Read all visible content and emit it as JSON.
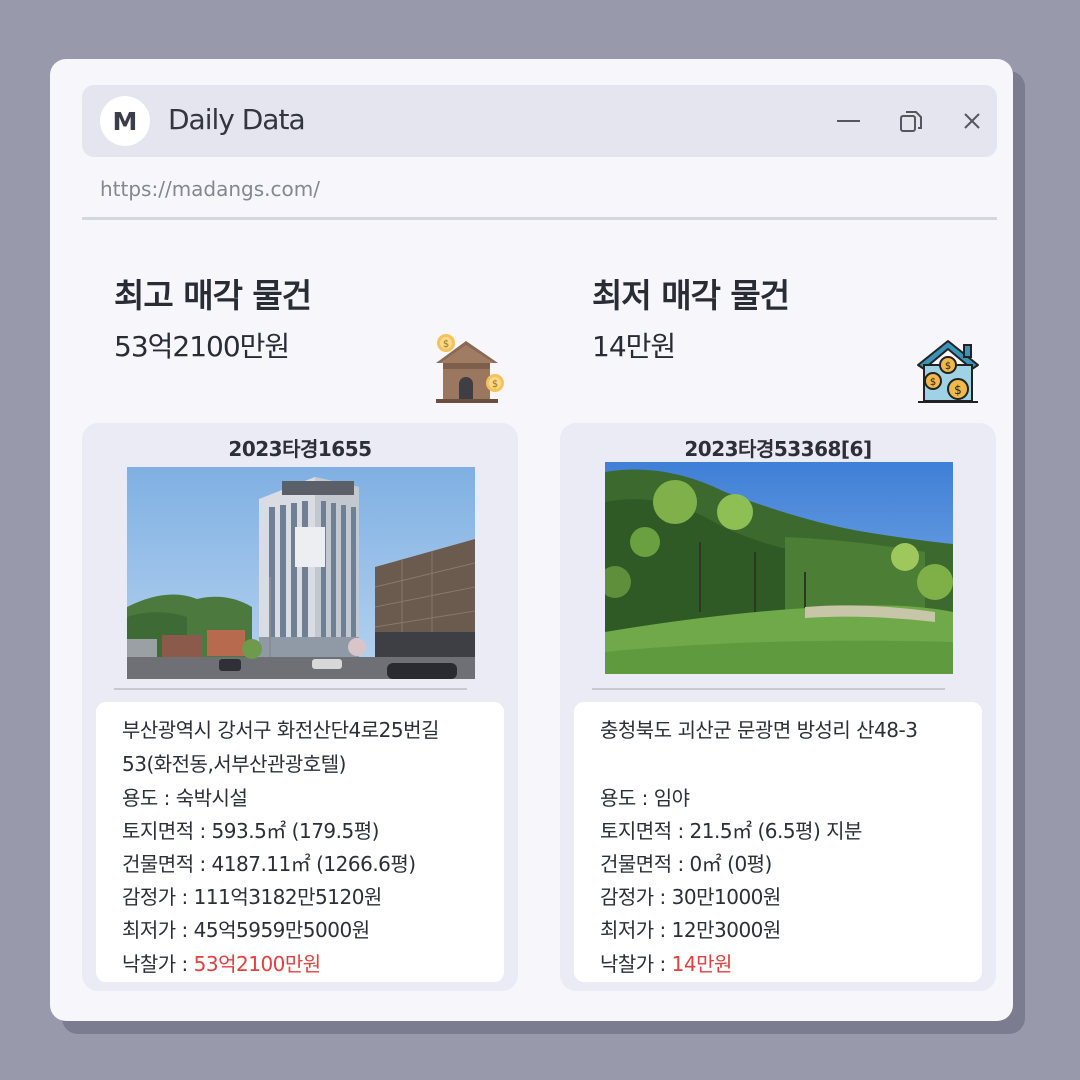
{
  "window": {
    "logo_letter": "M",
    "title": "Daily Data",
    "url": "https://madangs.com/"
  },
  "icons": {
    "minimize": "minimize-icon",
    "restore": "restore-icon",
    "close": "close-icon",
    "house_coin": "house-coin-icon",
    "house_money": "house-money-icon"
  },
  "highest": {
    "heading": "최고 매각 물건",
    "price": "53억2100만원",
    "case_no": "2023타경1655",
    "address_line1": "부산광역시 강서구 화전산단4로25번길",
    "address_line2": "53(화전동,서부산관광호텔)",
    "usage": "용도 : 숙박시설",
    "land_area": "토지면적 : 593.5㎡ (179.5평)",
    "building_area": "건물면적 : 4187.11㎡ (1266.6평)",
    "appraisal": "감정가 : 111억3182만5120원",
    "minimum": "최저가 : 45억5959만5000원",
    "winning_label": "낙찰가 : ",
    "winning_value": "53억2100만원"
  },
  "lowest": {
    "heading": "최저 매각 물건",
    "price": "14만원",
    "case_no": "2023타경53368[6]",
    "address_line1": "충청북도 괴산군 문광면 방성리 산48-3",
    "usage": "용도 : 임야",
    "land_area": "토지면적 : 21.5㎡ (6.5평) 지분",
    "building_area": "건물면적 : 0㎡ (0평)",
    "appraisal": "감정가 : 30만1000원",
    "minimum": "최저가 : 12만3000원",
    "winning_label": "낙찰가 : ",
    "winning_value": "14만원"
  },
  "colors": {
    "background": "#9899ab",
    "window": "#f6f6fb",
    "card": "#ebebf5",
    "highlight": "#e0403f"
  }
}
